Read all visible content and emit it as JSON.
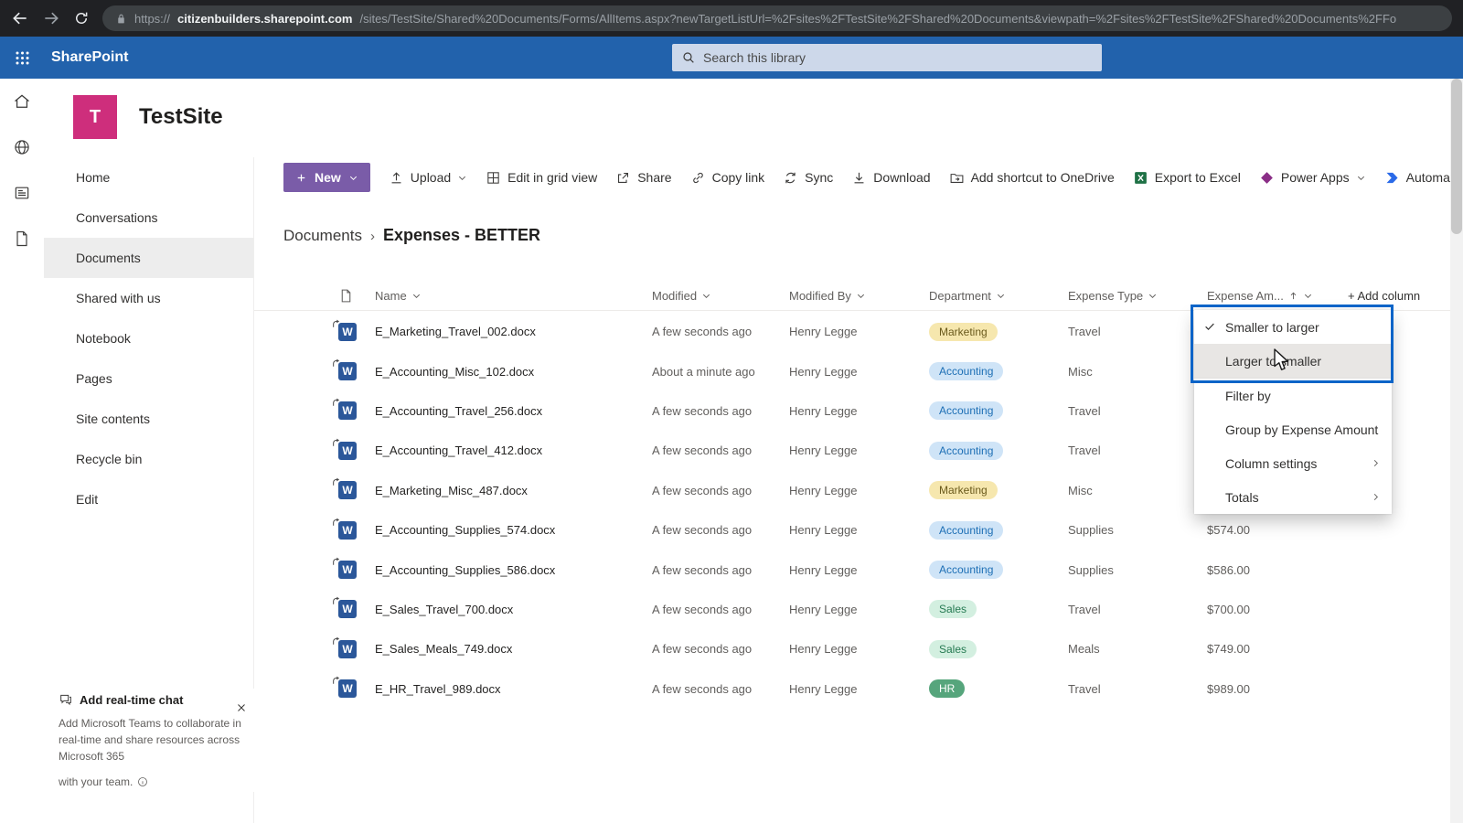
{
  "browser": {
    "url_scheme": "https://",
    "url_host": "citizenbuilders.sharepoint.com",
    "url_path": "/sites/TestSite/Shared%20Documents/Forms/AllItems.aspx?newTargetListUrl=%2Fsites%2FTestSite%2FShared%20Documents&viewpath=%2Fsites%2FTestSite%2FShared%20Documents%2FFo"
  },
  "suite_bar": {
    "app_name": "SharePoint",
    "search_placeholder": "Search this library"
  },
  "rail": {
    "icons": [
      "home-icon",
      "globe-icon",
      "news-icon",
      "document-icon"
    ]
  },
  "site": {
    "logo_letter": "T",
    "title": "TestSite"
  },
  "sidebar": {
    "items": [
      {
        "label": "Home",
        "active": false
      },
      {
        "label": "Conversations",
        "active": false
      },
      {
        "label": "Documents",
        "active": true
      },
      {
        "label": "Shared with us",
        "active": false
      },
      {
        "label": "Notebook",
        "active": false
      },
      {
        "label": "Pages",
        "active": false
      },
      {
        "label": "Site contents",
        "active": false
      },
      {
        "label": "Recycle bin",
        "active": false
      },
      {
        "label": "Edit",
        "active": false
      }
    ]
  },
  "toolbar": {
    "new_label": "New",
    "items": [
      {
        "label": "Upload",
        "icon": "upload-icon",
        "chevron": true
      },
      {
        "label": "Edit in grid view",
        "icon": "grid-icon",
        "chevron": false
      },
      {
        "label": "Share",
        "icon": "share-icon",
        "chevron": false
      },
      {
        "label": "Copy link",
        "icon": "link-icon",
        "chevron": false
      },
      {
        "label": "Sync",
        "icon": "sync-icon",
        "chevron": false
      },
      {
        "label": "Download",
        "icon": "download-icon",
        "chevron": false
      },
      {
        "label": "Add shortcut to OneDrive",
        "icon": "onedrive-shortcut-icon",
        "chevron": false
      },
      {
        "label": "Export to Excel",
        "icon": "excel-icon",
        "chevron": false
      },
      {
        "label": "Power Apps",
        "icon": "powerapps-icon",
        "chevron": true
      },
      {
        "label": "Automat",
        "icon": "automate-icon",
        "chevron": false
      }
    ]
  },
  "breadcrumb": {
    "parent": "Documents",
    "separator": "›",
    "current": "Expenses - BETTER"
  },
  "table": {
    "columns": [
      {
        "label": "Name",
        "chevron": true,
        "sorted_asc": false
      },
      {
        "label": "Modified",
        "chevron": true,
        "sorted_asc": false
      },
      {
        "label": "Modified By",
        "chevron": true,
        "sorted_asc": false
      },
      {
        "label": "Department",
        "chevron": true,
        "sorted_asc": false
      },
      {
        "label": "Expense Type",
        "chevron": true,
        "sorted_asc": false
      },
      {
        "label": "Expense Am...",
        "chevron": true,
        "sorted_asc": true
      }
    ],
    "add_column_label": "+ Add column",
    "rows": [
      {
        "name": "E_Marketing_Travel_002.docx",
        "modified": "A few seconds ago",
        "modified_by": "Henry Legge",
        "department": "Marketing",
        "expense_type": "Travel",
        "amount": ""
      },
      {
        "name": "E_Accounting_Misc_102.docx",
        "modified": "About a minute ago",
        "modified_by": "Henry Legge",
        "department": "Accounting",
        "expense_type": "Misc",
        "amount": ""
      },
      {
        "name": "E_Accounting_Travel_256.docx",
        "modified": "A few seconds ago",
        "modified_by": "Henry Legge",
        "department": "Accounting",
        "expense_type": "Travel",
        "amount": ""
      },
      {
        "name": "E_Accounting_Travel_412.docx",
        "modified": "A few seconds ago",
        "modified_by": "Henry Legge",
        "department": "Accounting",
        "expense_type": "Travel",
        "amount": ""
      },
      {
        "name": "E_Marketing_Misc_487.docx",
        "modified": "A few seconds ago",
        "modified_by": "Henry Legge",
        "department": "Marketing",
        "expense_type": "Misc",
        "amount": ""
      },
      {
        "name": "E_Accounting_Supplies_574.docx",
        "modified": "A few seconds ago",
        "modified_by": "Henry Legge",
        "department": "Accounting",
        "expense_type": "Supplies",
        "amount": "$574.00"
      },
      {
        "name": "E_Accounting_Supplies_586.docx",
        "modified": "A few seconds ago",
        "modified_by": "Henry Legge",
        "department": "Accounting",
        "expense_type": "Supplies",
        "amount": "$586.00"
      },
      {
        "name": "E_Sales_Travel_700.docx",
        "modified": "A few seconds ago",
        "modified_by": "Henry Legge",
        "department": "Sales",
        "expense_type": "Travel",
        "amount": "$700.00"
      },
      {
        "name": "E_Sales_Meals_749.docx",
        "modified": "A few seconds ago",
        "modified_by": "Henry Legge",
        "department": "Sales",
        "expense_type": "Meals",
        "amount": "$749.00"
      },
      {
        "name": "E_HR_Travel_989.docx",
        "modified": "A few seconds ago",
        "modified_by": "Henry Legge",
        "department": "HR",
        "expense_type": "Travel",
        "amount": "$989.00"
      }
    ]
  },
  "menu": {
    "items": [
      {
        "label": "Smaller to larger",
        "checked": true,
        "hovered": false,
        "submenu": false,
        "group_start": false
      },
      {
        "label": "Larger to smaller",
        "checked": false,
        "hovered": true,
        "submenu": false,
        "group_start": false
      },
      {
        "label": "Filter by",
        "checked": false,
        "hovered": false,
        "submenu": false,
        "group_start": true
      },
      {
        "label": "Group by Expense Amount",
        "checked": false,
        "hovered": false,
        "submenu": false,
        "group_start": false
      },
      {
        "label": "Column settings",
        "checked": false,
        "hovered": false,
        "submenu": true,
        "group_start": false
      },
      {
        "label": "Totals",
        "checked": false,
        "hovered": false,
        "submenu": true,
        "group_start": false
      }
    ]
  },
  "teams_promo": {
    "title": "Add real-time chat",
    "body": "Add Microsoft Teams to collaborate in real-time and share resources across Microsoft 365",
    "footer": "with your team."
  },
  "colors": {
    "suite_bar": "#2262ac",
    "new_button": "#7a5ca8",
    "site_logo": "#ce2e7c",
    "word_icon": "#2b579a",
    "excel_icon": "#1e7145",
    "highlight_box": "#0b64c8",
    "badges": {
      "Marketing": {
        "bg": "#f6e7ae",
        "text": "#6a5a1c"
      },
      "Accounting": {
        "bg": "#cfe4f7",
        "text": "#1d6fb5"
      },
      "Sales": {
        "bg": "#d3efe0",
        "text": "#267a52"
      },
      "HR": {
        "bg": "#56a57c",
        "text": "#ffffff"
      }
    }
  }
}
